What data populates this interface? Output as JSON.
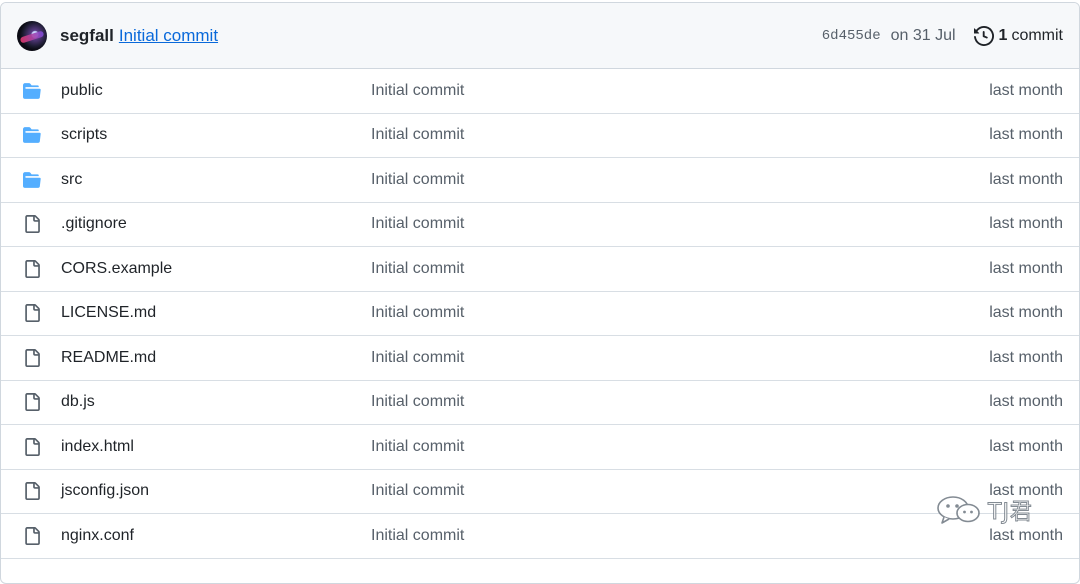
{
  "commit_header": {
    "author": "segfall",
    "message": "Initial commit",
    "sha": "6d455de",
    "date": "on 31 Jul",
    "history_count": "1",
    "history_label": "commit"
  },
  "files": [
    {
      "name": "public",
      "type": "folder",
      "message": "Initial commit",
      "age": "last month"
    },
    {
      "name": "scripts",
      "type": "folder",
      "message": "Initial commit",
      "age": "last month"
    },
    {
      "name": "src",
      "type": "folder",
      "message": "Initial commit",
      "age": "last month"
    },
    {
      "name": ".gitignore",
      "type": "file",
      "message": "Initial commit",
      "age": "last month"
    },
    {
      "name": "CORS.example",
      "type": "file",
      "message": "Initial commit",
      "age": "last month"
    },
    {
      "name": "LICENSE.md",
      "type": "file",
      "message": "Initial commit",
      "age": "last month"
    },
    {
      "name": "README.md",
      "type": "file",
      "message": "Initial commit",
      "age": "last month"
    },
    {
      "name": "db.js",
      "type": "file",
      "message": "Initial commit",
      "age": "last month"
    },
    {
      "name": "index.html",
      "type": "file",
      "message": "Initial commit",
      "age": "last month"
    },
    {
      "name": "jsconfig.json",
      "type": "file",
      "message": "Initial commit",
      "age": "last month"
    },
    {
      "name": "nginx.conf",
      "type": "file",
      "message": "Initial commit",
      "age": "last month"
    }
  ],
  "watermark": {
    "text": "TJ君"
  },
  "colors": {
    "folder": "#54aeff",
    "file_icon": "#57606a",
    "link": "#0969da",
    "header_bg": "#f6f8fa",
    "border": "#d0d7de"
  },
  "icons": {
    "folder": "folder-icon",
    "file": "file-icon",
    "history": "history-icon",
    "watermark": "wechat-icon"
  }
}
